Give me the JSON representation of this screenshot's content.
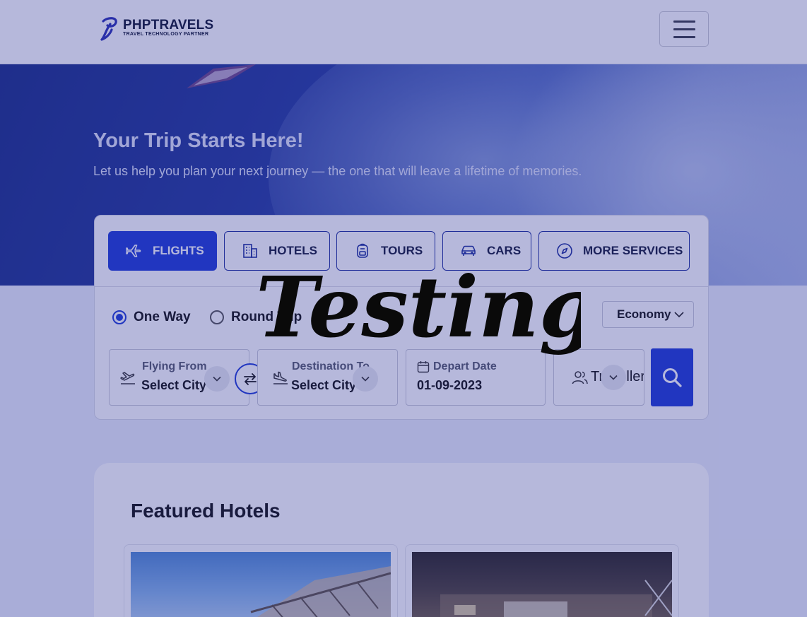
{
  "brand": {
    "name": "PHPTRAVELS",
    "tagline": "TRAVEL TECHNOLOGY PARTNER"
  },
  "hero": {
    "title": "Your Trip Starts Here!",
    "subtitle": "Let us help you plan your next journey — the one that will leave a lifetime of memories."
  },
  "tabs": [
    {
      "label": "FLIGHTS",
      "icon": "plane-icon",
      "active": true
    },
    {
      "label": "HOTELS",
      "icon": "building-icon",
      "active": false
    },
    {
      "label": "TOURS",
      "icon": "backpack-icon",
      "active": false
    },
    {
      "label": "CARS",
      "icon": "car-icon",
      "active": false
    },
    {
      "label": "MORE SERVICES",
      "icon": "compass-icon",
      "active": false
    }
  ],
  "trip_type": {
    "one_way": "One Way",
    "round_trip": "Round Trip",
    "selected": "One Way"
  },
  "cabin_class": "Economy",
  "fields": {
    "from": {
      "label": "Flying From",
      "value": "Select City"
    },
    "to": {
      "label": "Destination To",
      "value": "Select City"
    },
    "depart": {
      "label": "Depart Date",
      "value": "01-09-2023"
    },
    "travellers": {
      "value": "Travellers"
    }
  },
  "featured": {
    "title": "Featured Hotels"
  },
  "watermark": "Testing",
  "colors": {
    "accent": "#1e3bd6",
    "overlay": "#283096"
  }
}
